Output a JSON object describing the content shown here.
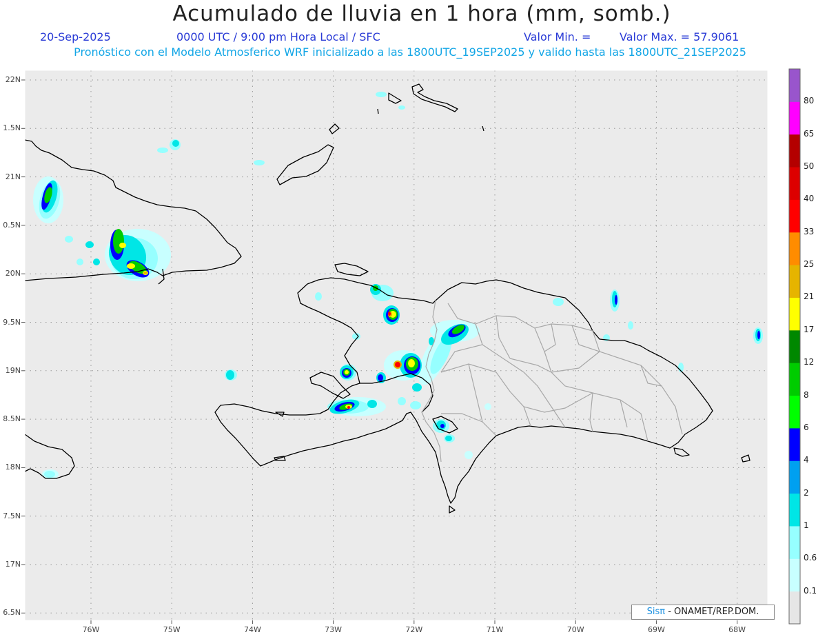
{
  "header": {
    "title": "Acumulado de lluvia en 1 hora (mm, somb.)",
    "date": "20-Sep-2025",
    "time": "0000 UTC / 9:00 pm Hora Local / SFC",
    "valmin": "Valor Min. =",
    "valmax": "Valor Max. = 57.9061",
    "forecast": "Pronóstico con el Modelo Atmosferico WRF inicializado a las 1800UTC_19SEP2025 y valido hasta las  1800UTC_21SEP2025"
  },
  "axes": {
    "lat_labels": [
      "22N",
      "1.5N",
      "21N",
      "0.5N",
      "20N",
      "9.5N",
      "19N",
      "8.5N",
      "18N",
      "7.5N",
      "17N",
      "6.5N"
    ],
    "lon_labels": [
      "76W",
      "75W",
      "74W",
      "73W",
      "72W",
      "71W",
      "70W",
      "69W",
      "68W"
    ]
  },
  "colorbar": {
    "colors": [
      "#e6e6e6",
      "#c8ffff",
      "#96ffff",
      "#00e6e6",
      "#00a0f0",
      "#0000ff",
      "#00ff00",
      "#00cc00",
      "#008800",
      "#ffff00",
      "#e6b400",
      "#ff8c00",
      "#ff0000",
      "#dd0000",
      "#b40000",
      "#ff00ff",
      "#9955cc"
    ],
    "labels": [
      "0.1",
      "0.6",
      "1",
      "2",
      "4",
      "6",
      "8",
      "12",
      "17",
      "21",
      "25",
      "33",
      "40",
      "50",
      "65",
      "80"
    ]
  },
  "credit": {
    "brand": "Sisπ",
    "text": " - ONAMET/REP.DOM."
  },
  "colors": {
    "ocean": "#ebebeb",
    "coast": "#000000",
    "province": "#a8a8a8",
    "grid": "#999999"
  }
}
